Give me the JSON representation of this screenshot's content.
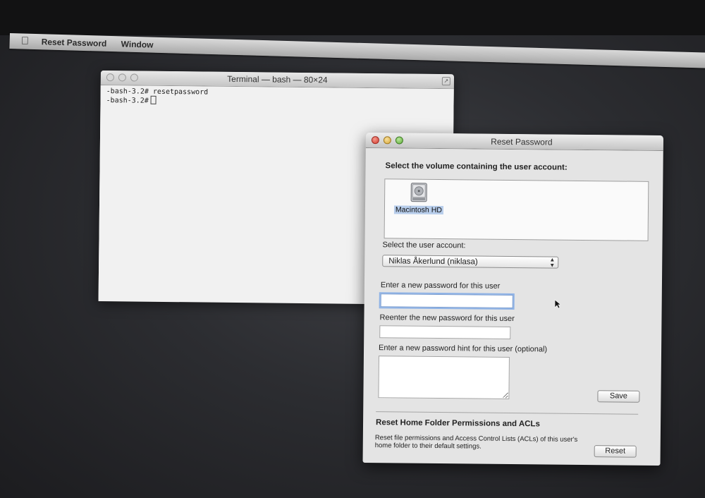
{
  "menubar": {
    "app_name": "Reset Password",
    "window_menu": "Window"
  },
  "terminal": {
    "title": "Terminal — bash — 80×24",
    "lines": [
      "-bash-3.2# resetpassword",
      "-bash-3.2#"
    ]
  },
  "reset_window": {
    "title": "Reset Password",
    "select_volume_label": "Select the volume containing the user account:",
    "volume_name": "Macintosh HD",
    "select_user_label": "Select the user account:",
    "selected_user": "Niklas Åkerlund (niklasa)",
    "new_password_label": "Enter a new password for this user",
    "new_password_value": "",
    "reenter_password_label": "Reenter the new password for this user",
    "reenter_password_value": "",
    "hint_label": "Enter a new password hint for this user (optional)",
    "hint_value": "",
    "save_button": "Save",
    "reset_section_title": "Reset Home Folder Permissions and ACLs",
    "reset_section_desc": "Reset file permissions and Access Control Lists (ACLs) of this user's home folder to their default settings.",
    "reset_button": "Reset"
  },
  "colors": {
    "selection": "#b7cdeb",
    "focus_ring": "#8fb3e6"
  }
}
